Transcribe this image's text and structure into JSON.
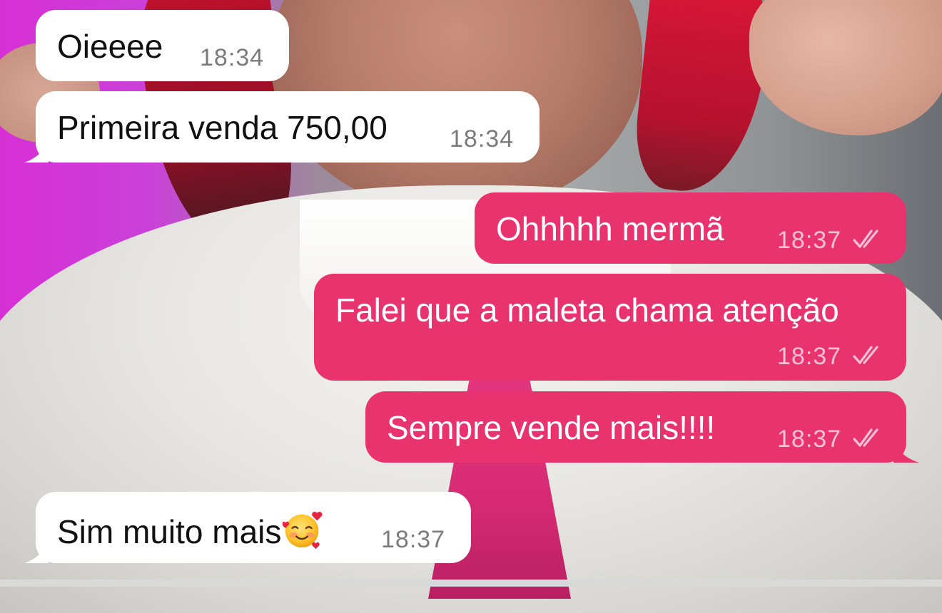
{
  "messages": [
    {
      "direction": "incoming",
      "text": "Oieeee",
      "time": "18:34"
    },
    {
      "direction": "incoming",
      "text": "Primeira venda 750,00",
      "time": "18:34"
    },
    {
      "direction": "outgoing",
      "text": "Ohhhhh mermã",
      "time": "18:37",
      "status": "read"
    },
    {
      "direction": "outgoing",
      "text": "Falei que a maleta chama atenção",
      "time": "18:37",
      "status": "read"
    },
    {
      "direction": "outgoing",
      "text": "Sempre vende mais!!!!",
      "time": "18:37",
      "status": "read"
    },
    {
      "direction": "incoming",
      "text": "Sim muito mais",
      "emoji": "smiling-face-with-hearts",
      "time": "18:37"
    }
  ],
  "colors": {
    "incoming_bubble": "#ffffff",
    "outgoing_bubble": "#e8336f",
    "incoming_time": "#7b7b7b",
    "outgoing_time": "#f6c2d3"
  },
  "icons": {
    "read_status": "double-check-icon",
    "emoji": "smiling-face-with-hearts-icon"
  }
}
